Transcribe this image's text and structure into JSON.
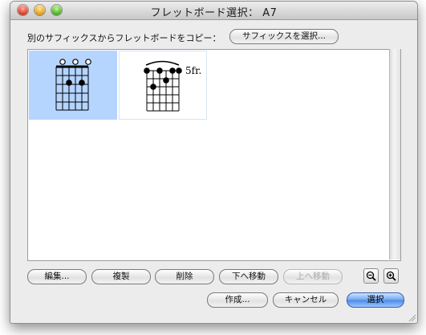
{
  "window": {
    "title": "フレットボード選択： A7"
  },
  "copy_row": {
    "label": "別のサフィックスからフレットボードをコピー：",
    "button_label": "サフィックスを選択..."
  },
  "chords": [
    {
      "name": "chord-diagram-a7-open",
      "selected": true,
      "fret_label": ""
    },
    {
      "name": "chord-diagram-a7-barre",
      "selected": false,
      "fret_label": "5fr."
    }
  ],
  "actions": {
    "edit": "編集...",
    "duplicate": "複製",
    "delete": "削除",
    "move_down": "下へ移動",
    "move_up": "上へ移動"
  },
  "footer": {
    "create": "作成...",
    "cancel": "キャンセル",
    "select": "選択"
  },
  "icons": {
    "zoom_out": "zoom-out-icon",
    "zoom_in": "zoom-in-icon"
  },
  "colors": {
    "selection": "#b5d5ff",
    "primary_button": "#4a8ae8"
  }
}
